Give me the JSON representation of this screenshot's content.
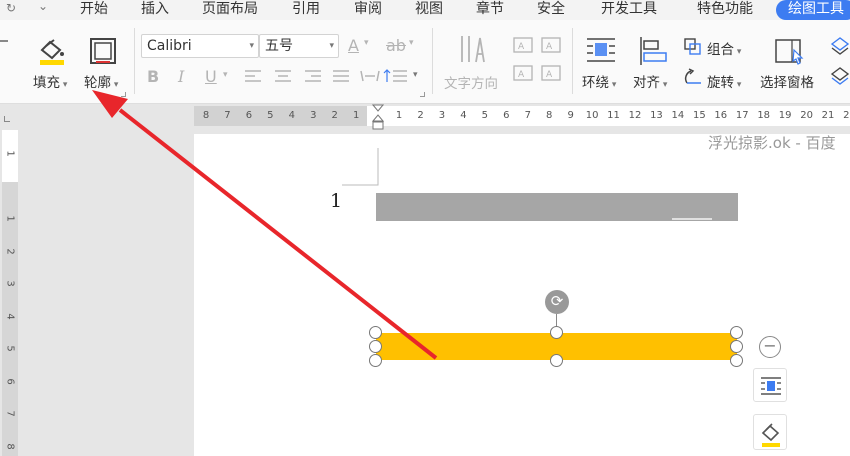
{
  "quick_access": {
    "redo_glyph": "↻",
    "more_glyph": "⌄"
  },
  "menu": {
    "tabs": [
      {
        "label": "开始"
      },
      {
        "label": "插入"
      },
      {
        "label": "页面布局"
      },
      {
        "label": "引用"
      },
      {
        "label": "审阅"
      },
      {
        "label": "视图"
      },
      {
        "label": "章节"
      },
      {
        "label": "安全"
      },
      {
        "label": "开发工具"
      },
      {
        "label": "特色功能"
      },
      {
        "label": "绘图工具",
        "active": true
      }
    ]
  },
  "ribbon": {
    "fill_label": "填充",
    "outline_label": "轮廓",
    "font_name": "Calibri",
    "font_size": "五号",
    "text_direction_label": "文字方向",
    "wrap_label": "环绕",
    "align_label": "对齐",
    "group_label": "组合",
    "rotate_label": "旋转",
    "selection_pane_label": "选择窗格",
    "format_bold": "B",
    "format_italic": "I",
    "format_underline": "U",
    "font_color_glyph": "A",
    "highlight_glyph": "ab"
  },
  "ruler": {
    "horizontal_ticks": [
      "8",
      "7",
      "6",
      "5",
      "4",
      "3",
      "2",
      "1",
      "",
      "1",
      "2",
      "3",
      "4",
      "5",
      "6",
      "7",
      "8",
      "9",
      "10",
      "11",
      "12",
      "13",
      "14",
      "15",
      "16",
      "17",
      "18",
      "19",
      "20",
      "21",
      "22"
    ],
    "vertical_ticks": [
      "1",
      "",
      "1",
      "2",
      "3",
      "4",
      "5",
      "6",
      "7",
      "8"
    ]
  },
  "document": {
    "page_number": "1",
    "header_text": "浮光掠影.ok - 百度"
  },
  "colors": {
    "accent_tab": "#3d7cf1",
    "shape_fill": "#ffc000",
    "gray_bar": "#a6a6a6",
    "annotation_arrow": "#e8262b"
  }
}
